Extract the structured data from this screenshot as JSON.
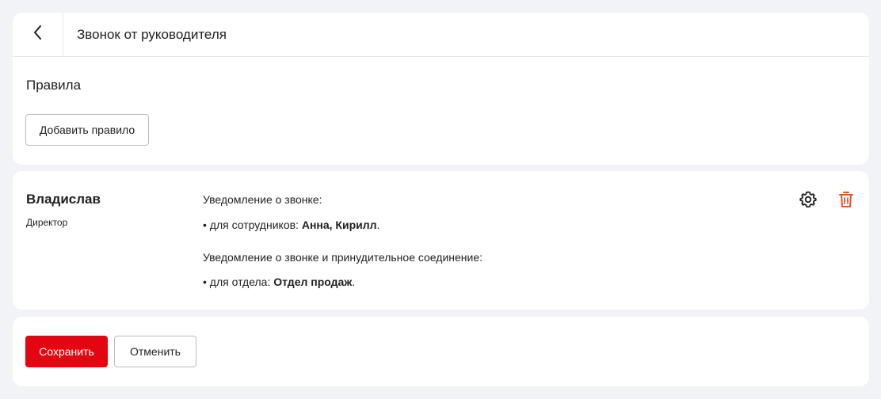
{
  "header": {
    "title": "Звонок от руководителя"
  },
  "rules_section": {
    "title": "Правила",
    "add_button": "Добавить правило"
  },
  "rule": {
    "name": "Владислав",
    "role": "Директор",
    "notify_label": "Уведомление о звонке:",
    "employees_prefix": "• для сотрудников: ",
    "employees_value": "Анна, Кирилл",
    "employees_suffix": ".",
    "forced_label": "Уведомление о звонке и принудительное соединение:",
    "department_prefix": "• для отдела: ",
    "department_value": "Отдел продаж",
    "department_suffix": ".",
    "icons": {
      "settings": "gear-icon",
      "delete": "trash-icon"
    }
  },
  "actions": {
    "save": "Сохранить",
    "cancel": "Отменить"
  },
  "colors": {
    "accent": "#e30611",
    "delete_icon": "#e0552e",
    "background": "#f2f3f7"
  }
}
